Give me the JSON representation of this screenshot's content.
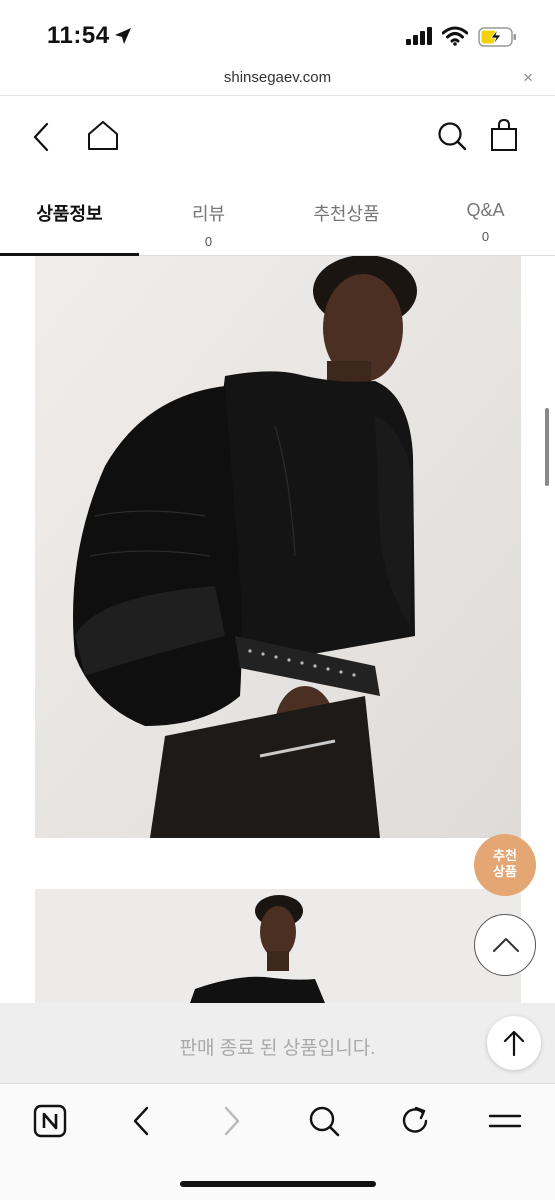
{
  "status_bar": {
    "time": "11:54",
    "icons": [
      "location-arrow-icon",
      "cellular-signal-icon",
      "wifi-icon",
      "battery-charging-icon"
    ]
  },
  "url_bar": {
    "url": "shinsegaev.com",
    "close": "×"
  },
  "nav": {
    "icons": [
      "back-chevron-icon",
      "home-icon",
      "search-icon",
      "shopping-bag-icon"
    ]
  },
  "tabs": [
    {
      "label": "상품정보",
      "count": "",
      "active": true
    },
    {
      "label": "리뷰",
      "count": "0",
      "active": false
    },
    {
      "label": "추천상품",
      "count": "",
      "active": false
    },
    {
      "label": "Q&A",
      "count": "0",
      "active": false
    }
  ],
  "floating": {
    "recommend_line1": "추천",
    "recommend_line2": "상품"
  },
  "sold_out": {
    "message": "판매 종료 된 상품입니다."
  },
  "browser_toolbar": {
    "icons": [
      "naver-n-icon",
      "back-icon",
      "forward-icon",
      "search-icon",
      "reload-icon",
      "menu-icon"
    ]
  },
  "colors": {
    "accent_recommend": "#e4a673",
    "sold_bar_bg": "#eeeeee",
    "sold_text": "#a9a9a9",
    "tab_active": "#111111",
    "battery_charging": "#f5d10a"
  }
}
